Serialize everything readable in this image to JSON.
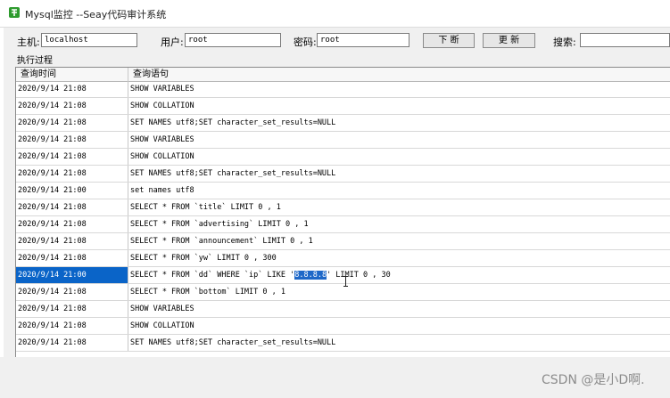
{
  "window": {
    "title": "Mysql监控 --Seay代码审计系统"
  },
  "form": {
    "host_label": "主机:",
    "host_value": "localhost",
    "user_label": "用户:",
    "user_value": "root",
    "pass_label": "密码:",
    "pass_value": "root",
    "disconnect_label": "下 断",
    "update_label": "更 新",
    "search_label": "搜索:",
    "search_value": ""
  },
  "section_label": "执行过程",
  "table": {
    "columns": [
      "查询时间",
      "查询语句"
    ],
    "selected_index": 10,
    "rows": [
      {
        "time": "2020/9/14 21:08",
        "query": "SHOW VARIABLES"
      },
      {
        "time": "2020/9/14 21:08",
        "query": "SHOW COLLATION"
      },
      {
        "time": "2020/9/14 21:08",
        "query": "SET NAMES utf8;SET character_set_results=NULL"
      },
      {
        "time": "2020/9/14 21:08",
        "query": "SHOW VARIABLES"
      },
      {
        "time": "2020/9/14 21:08",
        "query": "SHOW COLLATION"
      },
      {
        "time": "2020/9/14 21:08",
        "query": "SET NAMES utf8;SET character_set_results=NULL"
      },
      {
        "time": "2020/9/14 21:00",
        "query": "set names utf8"
      },
      {
        "time": "2020/9/14 21:08",
        "query": "SELECT * FROM `title` LIMIT 0 , 1"
      },
      {
        "time": "2020/9/14 21:08",
        "query": "SELECT * FROM `advertising` LIMIT 0 , 1"
      },
      {
        "time": "2020/9/14 21:08",
        "query": "SELECT * FROM `announcement` LIMIT 0 , 1"
      },
      {
        "time": "2020/9/14 21:08",
        "query": "SELECT * FROM `yw` LIMIT 0 , 300"
      },
      {
        "time": "2020/9/14 21:00",
        "query_pre": "SELECT * FROM `dd` WHERE `ip` LIKE '",
        "query_hl": "8.8.8.8",
        "query_post": "' LIMIT 0 , 30"
      },
      {
        "time": "2020/9/14 21:08",
        "query": "SELECT * FROM `bottom` LIMIT 0 , 1"
      },
      {
        "time": "2020/9/14 21:08",
        "query": "SHOW VARIABLES"
      },
      {
        "time": "2020/9/14 21:08",
        "query": "SHOW COLLATION"
      },
      {
        "time": "2020/9/14 21:08",
        "query": "SET NAMES utf8;SET character_set_results=NULL"
      }
    ]
  },
  "watermark": "CSDN @是小D啊.",
  "colors": {
    "selection": "#0a64c8",
    "icon": "#2e9b2e"
  }
}
